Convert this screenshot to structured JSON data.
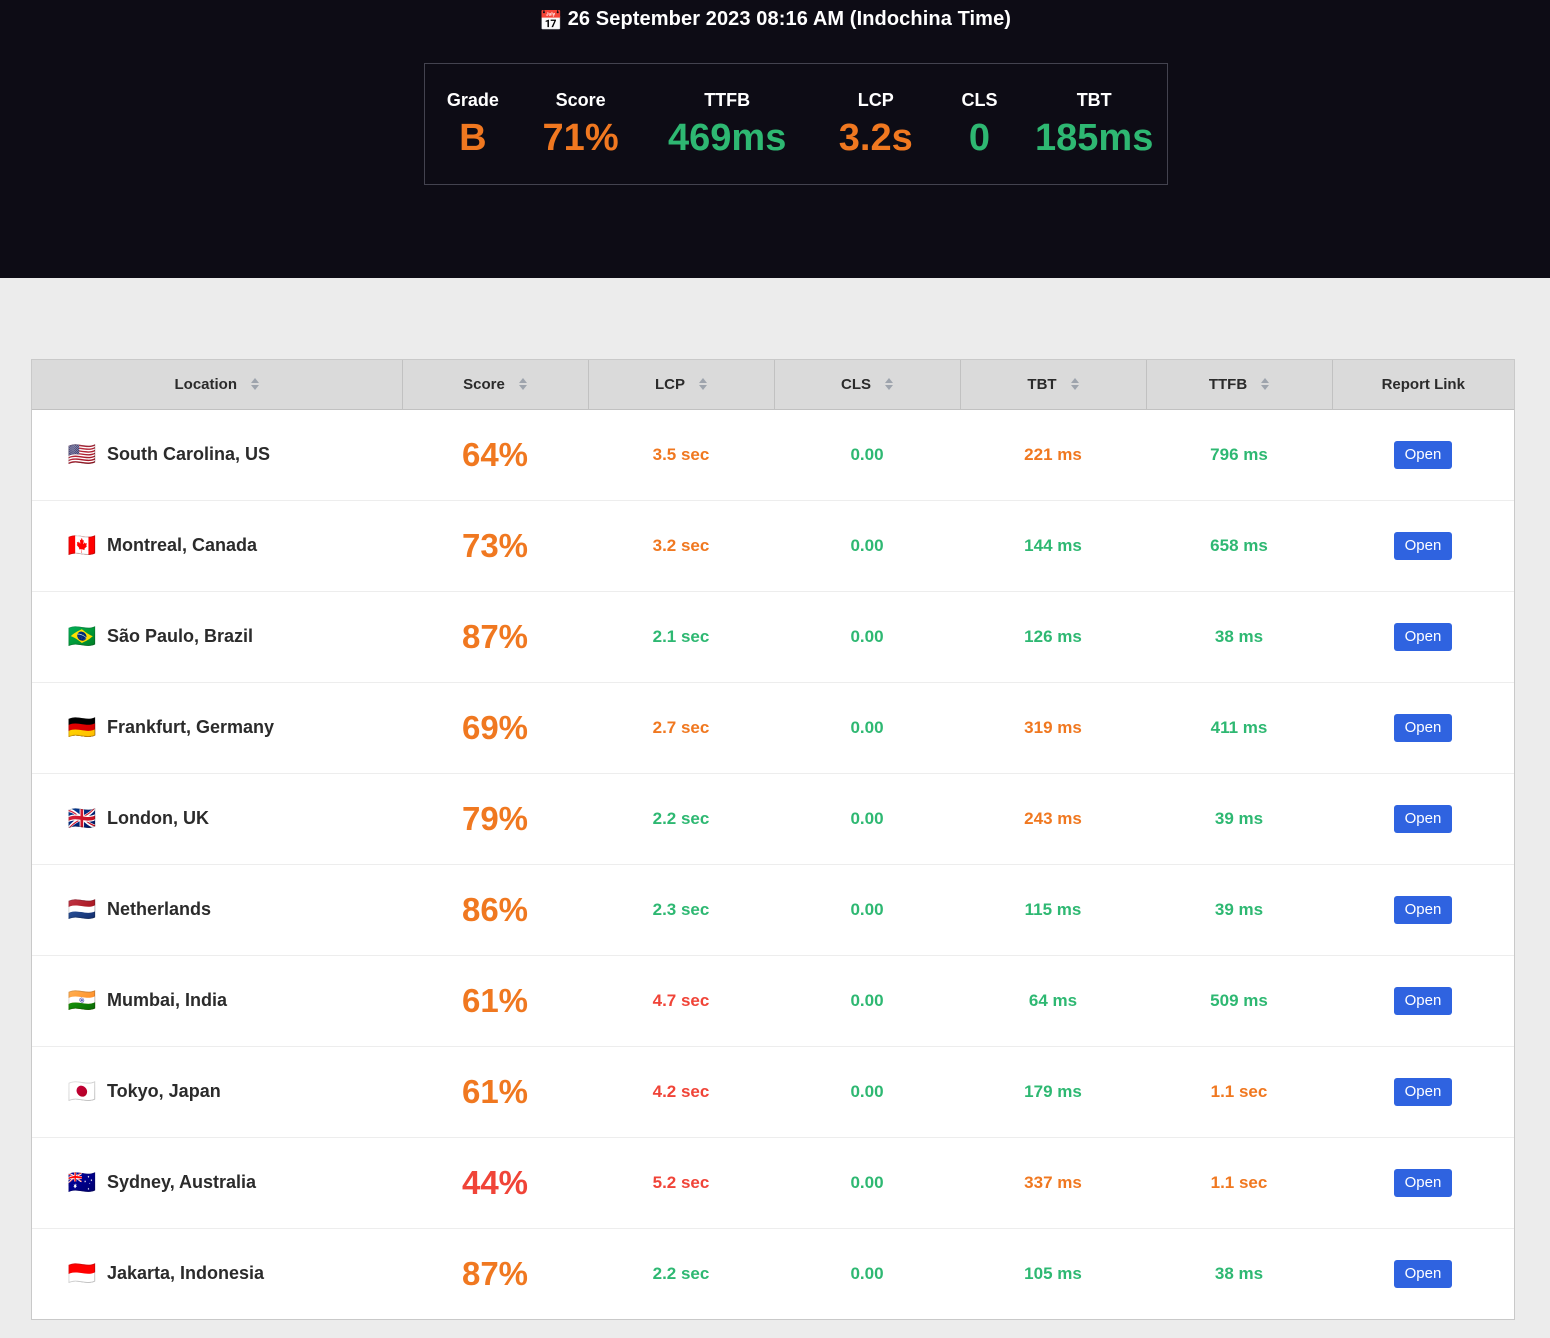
{
  "hero": {
    "calendar_icon": "calendar-icon",
    "calendar_glyph": "📅",
    "date_text": "26 September 2023 08:16 AM (Indochina Time)",
    "summary": [
      {
        "label": "Grade",
        "value": "B",
        "tone": "orange"
      },
      {
        "label": "Score",
        "value": "71%",
        "tone": "orange"
      },
      {
        "label": "TTFB",
        "value": "469ms",
        "tone": "green"
      },
      {
        "label": "LCP",
        "value": "3.2s",
        "tone": "orange"
      },
      {
        "label": "CLS",
        "value": "0",
        "tone": "green"
      },
      {
        "label": "TBT",
        "value": "185ms",
        "tone": "green"
      }
    ]
  },
  "table": {
    "columns": [
      {
        "label": "Location",
        "sortable": true
      },
      {
        "label": "Score",
        "sortable": true
      },
      {
        "label": "LCP",
        "sortable": true
      },
      {
        "label": "CLS",
        "sortable": true
      },
      {
        "label": "TBT",
        "sortable": true
      },
      {
        "label": "TTFB",
        "sortable": true
      },
      {
        "label": "Report Link",
        "sortable": false
      }
    ],
    "open_label": "Open",
    "rows": [
      {
        "flag": "🇺🇸",
        "location": "South Carolina, US",
        "score": "64%",
        "score_tone": "orange",
        "lcp": "3.5 sec",
        "lcp_tone": "orange",
        "cls": "0.00",
        "cls_tone": "green",
        "tbt": "221 ms",
        "tbt_tone": "orange",
        "ttfb": "796 ms",
        "ttfb_tone": "green"
      },
      {
        "flag": "🇨🇦",
        "location": "Montreal, Canada",
        "score": "73%",
        "score_tone": "orange",
        "lcp": "3.2 sec",
        "lcp_tone": "orange",
        "cls": "0.00",
        "cls_tone": "green",
        "tbt": "144 ms",
        "tbt_tone": "green",
        "ttfb": "658 ms",
        "ttfb_tone": "green"
      },
      {
        "flag": "🇧🇷",
        "location": "São Paulo, Brazil",
        "score": "87%",
        "score_tone": "orange",
        "lcp": "2.1 sec",
        "lcp_tone": "green",
        "cls": "0.00",
        "cls_tone": "green",
        "tbt": "126 ms",
        "tbt_tone": "green",
        "ttfb": "38 ms",
        "ttfb_tone": "green"
      },
      {
        "flag": "🇩🇪",
        "location": "Frankfurt, Germany",
        "score": "69%",
        "score_tone": "orange",
        "lcp": "2.7 sec",
        "lcp_tone": "orange",
        "cls": "0.00",
        "cls_tone": "green",
        "tbt": "319 ms",
        "tbt_tone": "orange",
        "ttfb": "411 ms",
        "ttfb_tone": "green"
      },
      {
        "flag": "🇬🇧",
        "location": "London, UK",
        "score": "79%",
        "score_tone": "orange",
        "lcp": "2.2 sec",
        "lcp_tone": "green",
        "cls": "0.00",
        "cls_tone": "green",
        "tbt": "243 ms",
        "tbt_tone": "orange",
        "ttfb": "39 ms",
        "ttfb_tone": "green"
      },
      {
        "flag": "🇳🇱",
        "location": "Netherlands",
        "score": "86%",
        "score_tone": "orange",
        "lcp": "2.3 sec",
        "lcp_tone": "green",
        "cls": "0.00",
        "cls_tone": "green",
        "tbt": "115 ms",
        "tbt_tone": "green",
        "ttfb": "39 ms",
        "ttfb_tone": "green"
      },
      {
        "flag": "🇮🇳",
        "location": "Mumbai, India",
        "score": "61%",
        "score_tone": "orange",
        "lcp": "4.7 sec",
        "lcp_tone": "red",
        "cls": "0.00",
        "cls_tone": "green",
        "tbt": "64 ms",
        "tbt_tone": "green",
        "ttfb": "509 ms",
        "ttfb_tone": "green"
      },
      {
        "flag": "🇯🇵",
        "location": "Tokyo, Japan",
        "score": "61%",
        "score_tone": "orange",
        "lcp": "4.2 sec",
        "lcp_tone": "red",
        "cls": "0.00",
        "cls_tone": "green",
        "tbt": "179 ms",
        "tbt_tone": "green",
        "ttfb": "1.1 sec",
        "ttfb_tone": "orange"
      },
      {
        "flag": "🇦🇺",
        "location": "Sydney, Australia",
        "score": "44%",
        "score_tone": "red",
        "lcp": "5.2 sec",
        "lcp_tone": "red",
        "cls": "0.00",
        "cls_tone": "green",
        "tbt": "337 ms",
        "tbt_tone": "orange",
        "ttfb": "1.1 sec",
        "ttfb_tone": "orange"
      },
      {
        "flag": "🇮🇩",
        "location": "Jakarta, Indonesia",
        "score": "87%",
        "score_tone": "orange",
        "lcp": "2.2 sec",
        "lcp_tone": "green",
        "cls": "0.00",
        "cls_tone": "green",
        "tbt": "105 ms",
        "tbt_tone": "green",
        "ttfb": "38 ms",
        "ttfb_tone": "green"
      }
    ]
  },
  "colors": {
    "orange": "#f07820",
    "green": "#2eb872",
    "red": "#f04438",
    "button_blue": "#2f63e0",
    "hero_bg": "#0d0c15",
    "page_bg": "#ececec"
  }
}
